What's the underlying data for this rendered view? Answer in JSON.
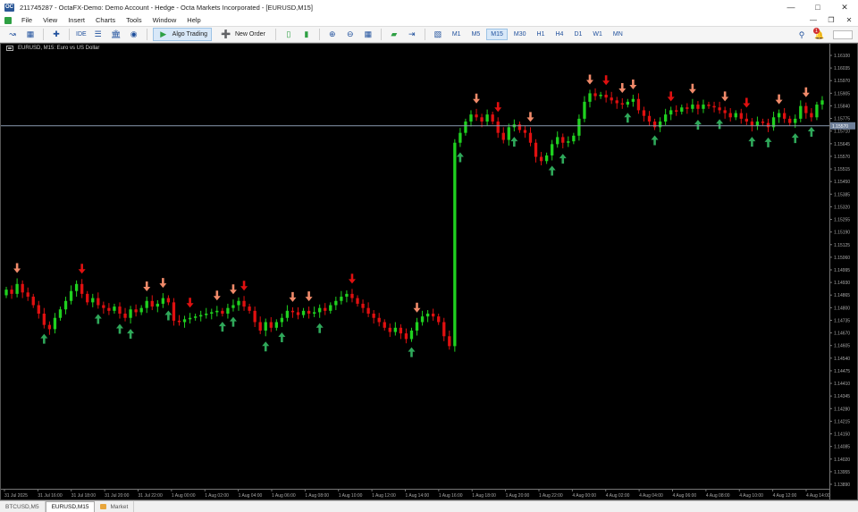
{
  "window": {
    "title": "211745287 - OctaFX-Demo: Demo Account - Hedge - Octa Markets Incorporated - [EURUSD,M15]",
    "icon_text": "OC"
  },
  "menu": {
    "items": [
      "File",
      "View",
      "Insert",
      "Charts",
      "Tools",
      "Window",
      "Help"
    ]
  },
  "toolbar": {
    "ide_label": "IDE",
    "algo_trading_label": "Algo Trading",
    "new_order_label": "New Order",
    "timeframes": [
      "M1",
      "M5",
      "M15",
      "M30",
      "H1",
      "H4",
      "D1",
      "W1",
      "MN"
    ],
    "active_timeframe": "M15",
    "notification_count": "1"
  },
  "chart": {
    "symbol_label": "EURUSD, M15:  Euro vs US Dollar",
    "current_price": "1.15570",
    "colors": {
      "background": "#000000",
      "bull": "#1fd11f",
      "bear": "#e01010",
      "axis_text": "#a8a8a8",
      "price_line": "#8a9bb0",
      "sell_arrow_light": "#f08a6a",
      "sell_arrow_strong": "#e01010",
      "buy_arrow": "#2fa85a"
    }
  },
  "chart_data": {
    "type": "candlestick",
    "symbol": "EURUSD",
    "timeframe": "M15",
    "ylim": [
      1.13,
      1.161
    ],
    "y_ticks": [
      "1.16100",
      "1.16035",
      "1.15970",
      "1.15905",
      "1.15840",
      "1.15775",
      "1.15710",
      "1.15645",
      "1.15570",
      "1.15515",
      "1.15450",
      "1.15385",
      "1.15320",
      "1.15255",
      "1.15190",
      "1.15125",
      "1.15060",
      "1.14995",
      "1.14930",
      "1.14865",
      "1.14800",
      "1.14735",
      "1.14670",
      "1.14605",
      "1.14540",
      "1.14475",
      "1.14410",
      "1.14345",
      "1.14280",
      "1.14215",
      "1.14150",
      "1.14085",
      "1.14020",
      "1.13955",
      "1.13890"
    ],
    "y_ticks_note": "labels as printed on right axis (partially legible)",
    "x_ticks": [
      "31 Jul 2025",
      "31 Jul 16:00",
      "31 Jul 18:00",
      "31 Jul 20:00",
      "31 Jul 22:00",
      "1 Aug 00:00",
      "1 Aug 02:00",
      "1 Aug 04:00",
      "1 Aug 06:00",
      "1 Aug 08:00",
      "1 Aug 10:00",
      "1 Aug 12:00",
      "1 Aug 14:00",
      "1 Aug 16:00",
      "1 Aug 18:00",
      "1 Aug 20:00",
      "1 Aug 22:00",
      "4 Aug 00:00",
      "4 Aug 02:00",
      "4 Aug 04:00",
      "4 Aug 06:00",
      "4 Aug 08:00",
      "4 Aug 10:00",
      "4 Aug 12:00",
      "4 Aug 14:00"
    ],
    "closes": [
      1.1441,
      1.1438,
      1.1445,
      1.1439,
      1.1436,
      1.143,
      1.1424,
      1.1416,
      1.1413,
      1.1421,
      1.1427,
      1.1433,
      1.144,
      1.1445,
      1.1438,
      1.1432,
      1.1435,
      1.143,
      1.1428,
      1.1426,
      1.1429,
      1.1424,
      1.1421,
      1.1427,
      1.1425,
      1.1428,
      1.1433,
      1.1429,
      1.1431,
      1.1435,
      1.1432,
      1.1419,
      1.1418,
      1.142,
      1.1421,
      1.1422,
      1.1423,
      1.1424,
      1.1425,
      1.1426,
      1.1424,
      1.1428,
      1.143,
      1.1433,
      1.1429,
      1.1426,
      1.1418,
      1.1412,
      1.1418,
      1.1414,
      1.1418,
      1.1421,
      1.1426,
      1.1425,
      1.1423,
      1.1426,
      1.1424,
      1.1425,
      1.1428,
      1.1426,
      1.143,
      1.1433,
      1.1436,
      1.1438,
      1.1435,
      1.1431,
      1.1428,
      1.1424,
      1.1421,
      1.1418,
      1.1414,
      1.1411,
      1.1414,
      1.141,
      1.1406,
      1.1412,
      1.1418,
      1.1422,
      1.1424,
      1.1422,
      1.1418,
      1.1408,
      1.1401,
      1.1545,
      1.1552,
      1.156,
      1.1565,
      1.1563,
      1.156,
      1.1565,
      1.156,
      1.1552,
      1.1547,
      1.1556,
      1.1558,
      1.1554,
      1.1552,
      1.1545,
      1.1535,
      1.1532,
      1.1536,
      1.1544,
      1.1549,
      1.1545,
      1.1546,
      1.155,
      1.1562,
      1.1574,
      1.158,
      1.1578,
      1.1579,
      1.1577,
      1.1575,
      1.1573,
      1.1572,
      1.1574,
      1.1576,
      1.1568,
      1.1564,
      1.156,
      1.1556,
      1.156,
      1.1565,
      1.1568,
      1.1567,
      1.157,
      1.1569,
      1.1572,
      1.1569,
      1.1572,
      1.1571,
      1.157,
      1.1568,
      1.1566,
      1.1563,
      1.1566,
      1.1562,
      1.156,
      1.1557,
      1.156,
      1.1559,
      1.1556,
      1.1563,
      1.1566,
      1.1562,
      1.1559,
      1.1562,
      1.1571,
      1.1566,
      1.1563,
      1.1572,
      1.1575
    ],
    "sell_signal_indices": [
      2,
      14,
      26,
      29,
      34,
      39,
      42,
      44,
      53,
      56,
      64,
      76,
      87,
      91,
      97,
      108,
      111,
      114,
      116,
      123,
      127,
      133,
      137,
      143,
      148
    ],
    "buy_signal_indices": [
      7,
      17,
      21,
      23,
      30,
      40,
      42,
      48,
      51,
      58,
      75,
      84,
      94,
      101,
      103,
      115,
      120,
      128,
      132,
      138,
      141,
      146,
      149
    ]
  },
  "tabs": [
    {
      "label": "BTCUSD,M5",
      "active": false
    },
    {
      "label": "EURUSD,M15",
      "active": true
    },
    {
      "label": "Market",
      "active": false
    }
  ]
}
